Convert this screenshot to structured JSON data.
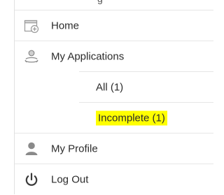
{
  "top_fragment": "g",
  "menu": {
    "items": [
      {
        "label": "Home",
        "icon": "home-icon"
      },
      {
        "label": "My Applications",
        "icon": "applications-icon"
      },
      {
        "label": "All (1)",
        "icon": ""
      },
      {
        "label": "Incomplete (1)",
        "icon": ""
      },
      {
        "label": "My Profile",
        "icon": "profile-icon"
      },
      {
        "label": "Log Out",
        "icon": "power-icon"
      }
    ]
  },
  "colors": {
    "highlight": "#ffff00",
    "divider": "#e6e6e6",
    "icon_gray": "#8a8a8a"
  }
}
